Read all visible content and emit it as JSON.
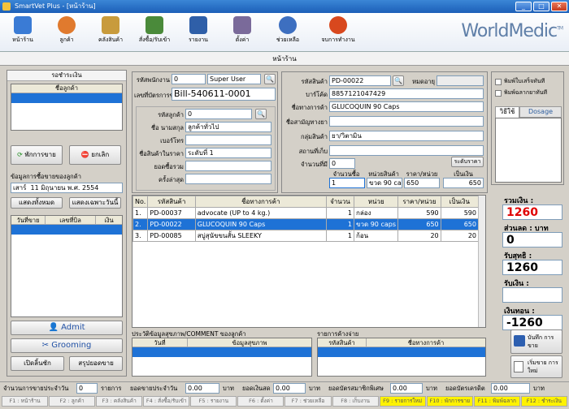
{
  "window": {
    "title": "SmartVet Plus - [หน้าร้าน]"
  },
  "toolbar": {
    "items": [
      {
        "label": "หน้าร้าน",
        "icon": "cash-register-icon"
      },
      {
        "label": "ลูกค้า",
        "icon": "customers-icon"
      },
      {
        "label": "คลังสินค้า",
        "icon": "inventory-icon"
      },
      {
        "label": "สั่งซื้อ/รับเข้า",
        "icon": "cart-icon"
      },
      {
        "label": "รายงาน",
        "icon": "report-icon"
      },
      {
        "label": "ตั้งค่า",
        "icon": "settings-icon"
      },
      {
        "label": "ช่วยเหลือ",
        "icon": "help-icon"
      },
      {
        "label": "จบการทำงาน",
        "icon": "exit-icon"
      }
    ],
    "brand": "WorldMedic",
    "brand_tm": "TM"
  },
  "nav": {
    "title": "หน้าร้าน"
  },
  "left": {
    "queue_header": "รอชำระเงิน",
    "queue_col": "ชื่อลูกค้า",
    "hold_button": "พักการขาย",
    "cancel_button": "ยกเลิก",
    "history_title": "ข้อมูลการซื้อขายของลูกค้า",
    "date_prefix": "เสาร์",
    "date_day": "11",
    "date_month": "มิถุนายน",
    "date_era": "พ.ศ.",
    "date_year": "2554",
    "show_all": "แสดงทั้งหมด",
    "show_today": "แสดงเฉพาะวันนี้",
    "history_cols": [
      "วันที่ขาย",
      "เลขที่บิล",
      "เงิน"
    ],
    "admit_button": "Admit",
    "grooming_button": "Grooming",
    "open_drawer": "เปิดลิ้นชัก",
    "summary_sales": "สรุปยอดขาย"
  },
  "sale": {
    "staff_label": "รหัสพนักงาน",
    "staff_code": "0",
    "staff_name": "Super User",
    "bill_label": "เลขที่บัตรการขาย",
    "bill_no": "Bill-540611-0001",
    "cust_code_label": "รหัสลูกค้า",
    "cust_code": "0",
    "cust_name_label": "ชื่อ นามสกุล",
    "cust_name": "ลูกค้าทั่วไป",
    "phone_label": "เบอร์โทร",
    "phone": "",
    "price_level_label": "ชื่อสินค้าในราคา",
    "price_level": "ระดับที่ 1",
    "total_buy_label": "ยอดซื้อรวม",
    "total_buy": "",
    "last_label": "ครั้งล่าสุด",
    "last": ""
  },
  "product": {
    "code_label": "รหัสสินค้า",
    "code": "PD-00022",
    "expiry_label": "หมดอายุ",
    "expiry": "",
    "barcode_label": "บาร์โค้ด",
    "barcode": "8857121047429",
    "trade_label": "ชื่อทางการค้า",
    "trade": "GLUCOQUIN 90 Caps",
    "generic_label": "ชื่อสามัญทางยา",
    "generic": "",
    "group_label": "กลุ่มสินค้า",
    "group": "ยา/วิตามิน",
    "location_label": "สถานที่เก็บ",
    "location": "",
    "stock_label": "จำนวนที่มี",
    "stock": "0",
    "price_level_btn": "ระดับราคา",
    "qty_label": "จำนวนซื้อ",
    "qty": "1",
    "unit_label": "หน่วยสินค้า",
    "unit": "ขวด 90 caps",
    "price_label": "ราคา/หน่วย",
    "price": "650",
    "amount_label": "เป็นเงิน",
    "amount": "650"
  },
  "options": {
    "print_receipt": "พิมพ์ใบเสร็จทันที",
    "print_label": "พิมพ์ฉลากยาทันที",
    "usage_tab": "วิธีใช้",
    "dosage_tab": "Dosage"
  },
  "items": {
    "cols": [
      "No.",
      "รหัสสินค้า",
      "ชื่อทางการค้า",
      "จำนวน",
      "หน่วย",
      "ราคา/หน่วย",
      "เป็นเงิน"
    ],
    "rows": [
      {
        "no": "1.",
        "code": "PD-00037",
        "name": "advocate (UP to 4 kg.)",
        "qty": "1",
        "unit": "กล่อง",
        "price": "590",
        "amount": "590"
      },
      {
        "no": "2.",
        "code": "PD-00022",
        "name": "GLUCOQUIN 90 Caps",
        "qty": "1",
        "unit": "ขวด 90 caps",
        "price": "650",
        "amount": "650"
      },
      {
        "no": "3.",
        "code": "PD-00085",
        "name": "สบู่สุนัขขนสั้น SLEEKY",
        "qty": "1",
        "unit": "ก้อน",
        "price": "20",
        "amount": "20"
      }
    ]
  },
  "totals": {
    "total_label": "รวมเงิน :",
    "total": "1260",
    "discount_label": "ส่วนลด : บาท",
    "discount": "0",
    "net_label": "รับสุทธิ :",
    "net": "1260",
    "received_label": "รับเงิน :",
    "received": "",
    "change_label": "เงินทอน :",
    "change": "-1260",
    "save_button": "บันทึก การขาย",
    "new_button": "เริ่มขาย การใหม่"
  },
  "history": {
    "title": "ประวัติข้อมูลสุขภาพ/COMMENT ของลูกค้า",
    "cols": [
      "วันที่",
      "ข้อมูลสุขภาพ"
    ]
  },
  "pending": {
    "title": "รายการค้างจ่าย",
    "cols": [
      "รหัสสินค้า",
      "ชื่อทางการค้า"
    ]
  },
  "status": {
    "count_label": "จำนวนการขายประจำวัน",
    "count": "0",
    "count_unit": "รายการ",
    "daily_label": "ยอดขายประจำวัน",
    "daily": "0.00",
    "daily_unit": "บาท",
    "cash_label": "ยอดเงินสด",
    "cash": "0.00",
    "cash_unit": "บาท",
    "member_label": "ยอดบัตรสมาชิกพิเศษ",
    "member": "0.00",
    "member_unit": "บาท",
    "credit_label": "ยอดบัตรเครดิต",
    "credit": "0.00",
    "credit_unit": "บาท"
  },
  "fkeys": [
    "F1 : หน้าร้าน",
    "F2 : ลูกค้า",
    "F3 : คลังสินค้า",
    "F4 : สั่งซื้อ/รับเข้า",
    "F5 : รายงาน",
    "F6 : ตั้งค่า",
    "F7 : ช่วยเหลือ",
    "F8 : เก็บงาน",
    "F9 : รายการใหม่",
    "F10 : พักการขาย",
    "F11 : พิมพ์ฉลาก",
    "F12 : ชำระเงิน"
  ],
  "colors": {
    "accent": "#1e72d6",
    "total_red": "#e00000",
    "fkey_yellow": "#fff200"
  }
}
